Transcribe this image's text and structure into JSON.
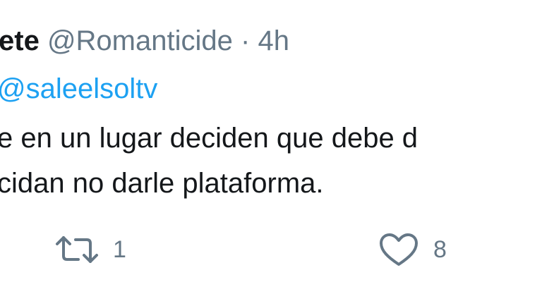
{
  "tweet": {
    "author_name": "ete",
    "author_handle": "@Romanticide",
    "separator": "·",
    "time": "4h",
    "reply_mention": "@saleelsoltv",
    "body_line_1": "e en un lugar deciden que debe d",
    "body_line_2": "cidan no darle plataforma."
  },
  "actions": {
    "retweet": {
      "icon": "retweet-icon",
      "count": "1"
    },
    "like": {
      "icon": "heart-icon",
      "count": "8"
    }
  },
  "colors": {
    "text": "#14171a",
    "secondary": "#657786",
    "accent": "#1da1f2",
    "background": "#ffffff"
  }
}
